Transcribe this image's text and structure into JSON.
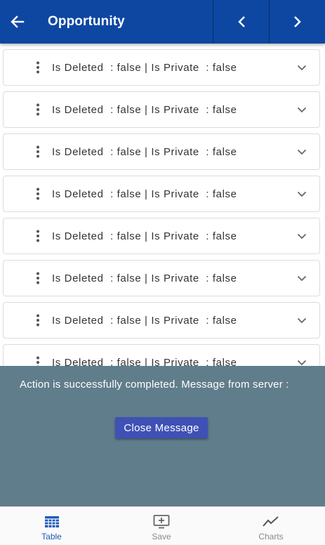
{
  "header": {
    "title": "Opportunity"
  },
  "list": {
    "items": [
      {
        "label": "Is Deleted  : false | Is Private  : false"
      },
      {
        "label": "Is Deleted  : false | Is Private  : false"
      },
      {
        "label": "Is Deleted  : false | Is Private  : false"
      },
      {
        "label": "Is Deleted  : false | Is Private  : false"
      },
      {
        "label": "Is Deleted  : false | Is Private  : false"
      },
      {
        "label": "Is Deleted  : false | Is Private  : false"
      },
      {
        "label": "Is Deleted  : false | Is Private  : false"
      },
      {
        "label": "Is Deleted  : false | Is Private  : false"
      }
    ]
  },
  "message": {
    "text": " Action is successfully completed. Message from server :",
    "close_label": "Close Message"
  },
  "bottom_nav": {
    "tabs": [
      {
        "label": "Table",
        "icon": "table-grid-icon",
        "active": true
      },
      {
        "label": "Save",
        "icon": "monitor-plus-icon",
        "active": false
      },
      {
        "label": "Charts",
        "icon": "line-chart-icon",
        "active": false
      }
    ]
  },
  "colors": {
    "header_bg": "#0d47a1",
    "overlay_bg": "#607d8b",
    "button_bg": "#3f51b5",
    "active_tab": "#1e5bb8",
    "inactive_tab": "#8a8a8a"
  }
}
